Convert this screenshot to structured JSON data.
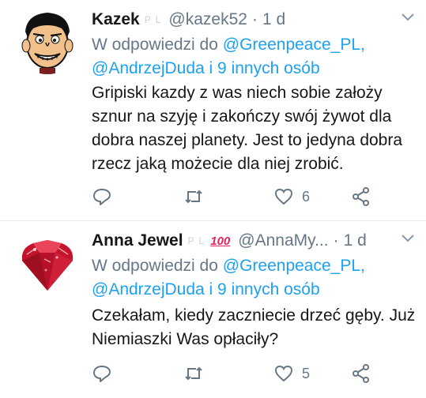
{
  "tweets": [
    {
      "name": "Kazek",
      "badges": [
        "P",
        "L"
      ],
      "handle": "@kazek52",
      "time": "1 d",
      "reply_prefix": "W odpowiedzi do",
      "reply_mention_1": "@Greenpeace_PL,",
      "reply_mention_2": "@AndrzejDuda i 9 innych osób",
      "body": "Gripiski kazdy z was niech sobie założy sznur na szyję i zakończy swój żywot dla dobra naszej planety. Jest to jedyna dobra rzecz jaką możecie dla niej zrobić.",
      "like_count": "6"
    },
    {
      "name": "Anna Jewel",
      "badges": [
        "P",
        "L"
      ],
      "emoji": "100",
      "handle": "@AnnaMy...",
      "time": "1 d",
      "reply_prefix": "W odpowiedzi do",
      "reply_mention_1": "@Greenpeace_PL,",
      "reply_mention_2": "@AndrzejDuda i 9 innych osób",
      "body": "Czekałam, kiedy zaczniecie drzeć gęby. Już Niemiaszki Was opłaciły?",
      "like_count": "5"
    }
  ],
  "colors": {
    "link": "#1da1f2",
    "secondary": "#657786",
    "text": "#14171a",
    "divider": "#e6ecf0"
  },
  "icons": [
    "reply-icon",
    "retweet-icon",
    "like-icon",
    "share-icon",
    "chevron-down-icon"
  ]
}
